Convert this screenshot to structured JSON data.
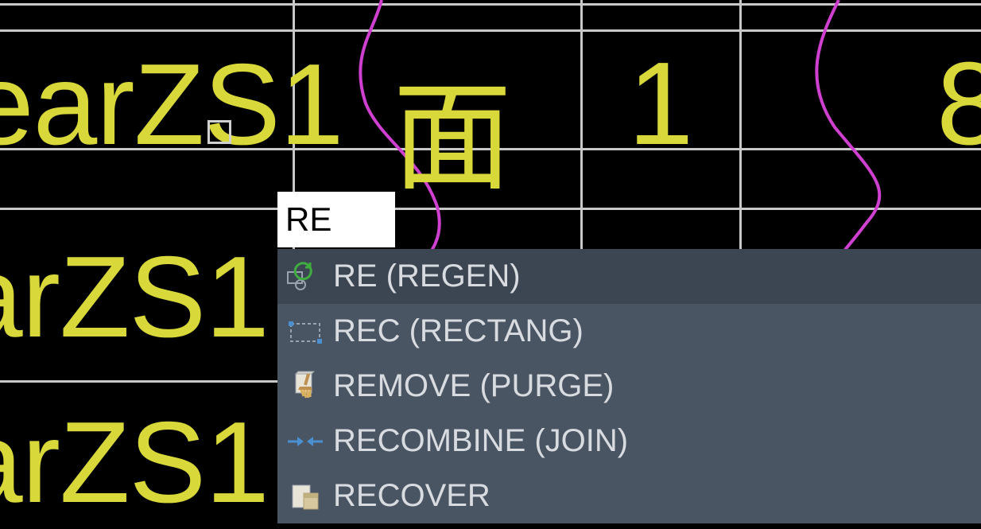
{
  "canvas_texts": {
    "t1": "earZS1",
    "t2": "arZS1",
    "t3": "arZS1",
    "t4": "面",
    "t5": "1",
    "t6": "8"
  },
  "command_input": {
    "value": "RE"
  },
  "autocomplete": {
    "items": [
      {
        "label": "RE (REGEN)"
      },
      {
        "label": "REC (RECTANG)"
      },
      {
        "label": "REMOVE (PURGE)"
      },
      {
        "label": "RECOMBINE (JOIN)"
      },
      {
        "label": "RECOVER"
      }
    ]
  }
}
